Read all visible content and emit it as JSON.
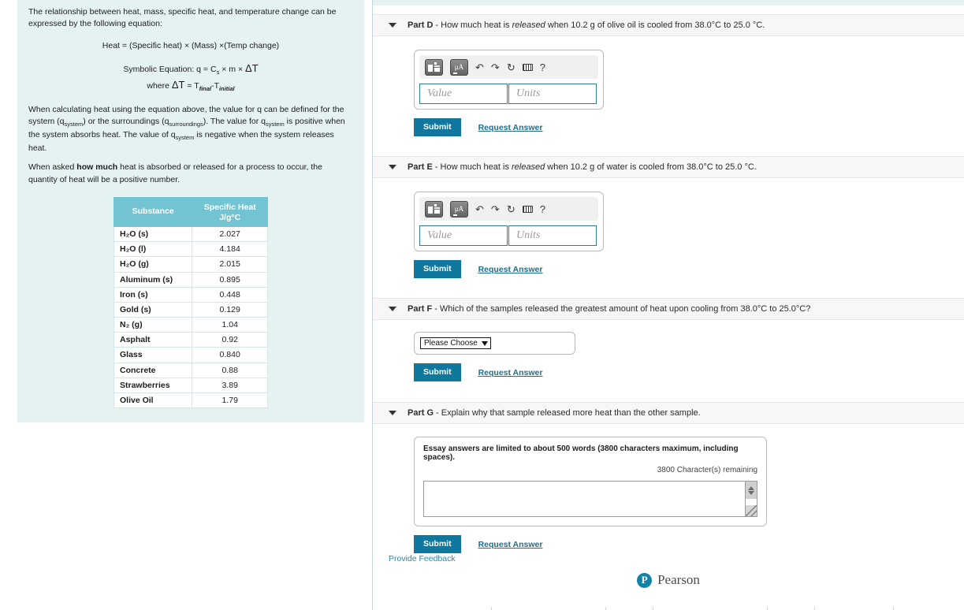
{
  "left_panel": {
    "intro_line1": "The relationship between heat, mass, specific heat, and temperature change can be expressed by the following equation:",
    "equation_word": "Heat = (Specific heat) × (Mass) ×(Temp change)",
    "symbolic_label": "Symbolic Equation: q = C",
    "symbolic_sub": "s",
    "symbolic_rest": " × m × ",
    "delta_t": "ΔT",
    "where_prefix": "where ",
    "where_delta": "ΔT",
    "where_eq": " = T",
    "where_final": "final",
    "where_minus": "-T",
    "where_initial": "initial",
    "para2_a": "When calculating heat using the equation above, the value for q can be defined for the system (q",
    "para2_sub1": "system",
    "para2_b": ") or the surroundings (q",
    "para2_sub2": "surroundings",
    "para2_c": "). The value for q",
    "para2_sub3": "system",
    "para2_d": " is positive when the system absorbs heat. The value of q",
    "para2_sub4": "system",
    "para2_e": " is negative when the system releases heat.",
    "para3_a": "When asked ",
    "para3_bold": "how much",
    "para3_b": " heat is absorbed or released for a process to occur, the quantity of heat will be a positive number.",
    "table": {
      "header_substance": "Substance",
      "header_specific_heat_line1": "Specific Heat",
      "header_specific_heat_line2": "J/g°C",
      "rows": [
        {
          "substance": "H₂O (s)",
          "value": "2.027"
        },
        {
          "substance": "H₂O (l)",
          "value": "4.184"
        },
        {
          "substance": "H₂O (g)",
          "value": "2.015"
        },
        {
          "substance": "Aluminum (s)",
          "value": "0.895"
        },
        {
          "substance": "Iron (s)",
          "value": "0.448"
        },
        {
          "substance": "Gold (s)",
          "value": "0.129"
        },
        {
          "substance": "N₂ (g)",
          "value": "1.04"
        },
        {
          "substance": "Asphalt",
          "value": "0.92"
        },
        {
          "substance": "Glass",
          "value": "0.840"
        },
        {
          "substance": "Concrete",
          "value": "0.88"
        },
        {
          "substance": "Strawberries",
          "value": "3.89"
        },
        {
          "substance": "Olive Oil",
          "value": "1.79"
        }
      ]
    }
  },
  "parts": {
    "d": {
      "label": "Part D",
      "question_a": " - How much heat is ",
      "question_em": "released",
      "question_b": " when 10.2 g of olive oil is cooled from 38.0°C to 25.0 °C.",
      "value_placeholder": "Value",
      "units_placeholder": "Units",
      "submit_label": "Submit",
      "request_label": "Request Answer"
    },
    "e": {
      "label": "Part E",
      "question_a": " - How much heat is ",
      "question_em": "released",
      "question_b": " when 10.2 g of water is cooled from 38.0°C to 25.0 °C.",
      "value_placeholder": "Value",
      "units_placeholder": "Units",
      "submit_label": "Submit",
      "request_label": "Request Answer"
    },
    "f": {
      "label": "Part F",
      "question": " - Which of the samples released the greatest amount of heat upon cooling from 38.0°C to 25.0°C?",
      "dropdown_selected": "Please Choose",
      "submit_label": "Submit",
      "request_label": "Request Answer"
    },
    "g": {
      "label": "Part G",
      "question": " - Explain why that sample released more heat than the other sample.",
      "essay_note": "Essay answers are limited to about 500 words (3800 characters maximum, including spaces).",
      "characters_remaining": "3800 Character(s) remaining",
      "essay_value": "",
      "submit_label": "Submit",
      "request_label": "Request Answer"
    }
  },
  "footer": {
    "feedback_label": "Provide Feedback",
    "brand_mark": "P",
    "brand_name": "Pearson"
  },
  "colors": {
    "accent_teal": "#10789e",
    "panel_mint": "#e4f2f1",
    "table_header": "#72c4d3",
    "link_blue": "#1c6f93"
  }
}
